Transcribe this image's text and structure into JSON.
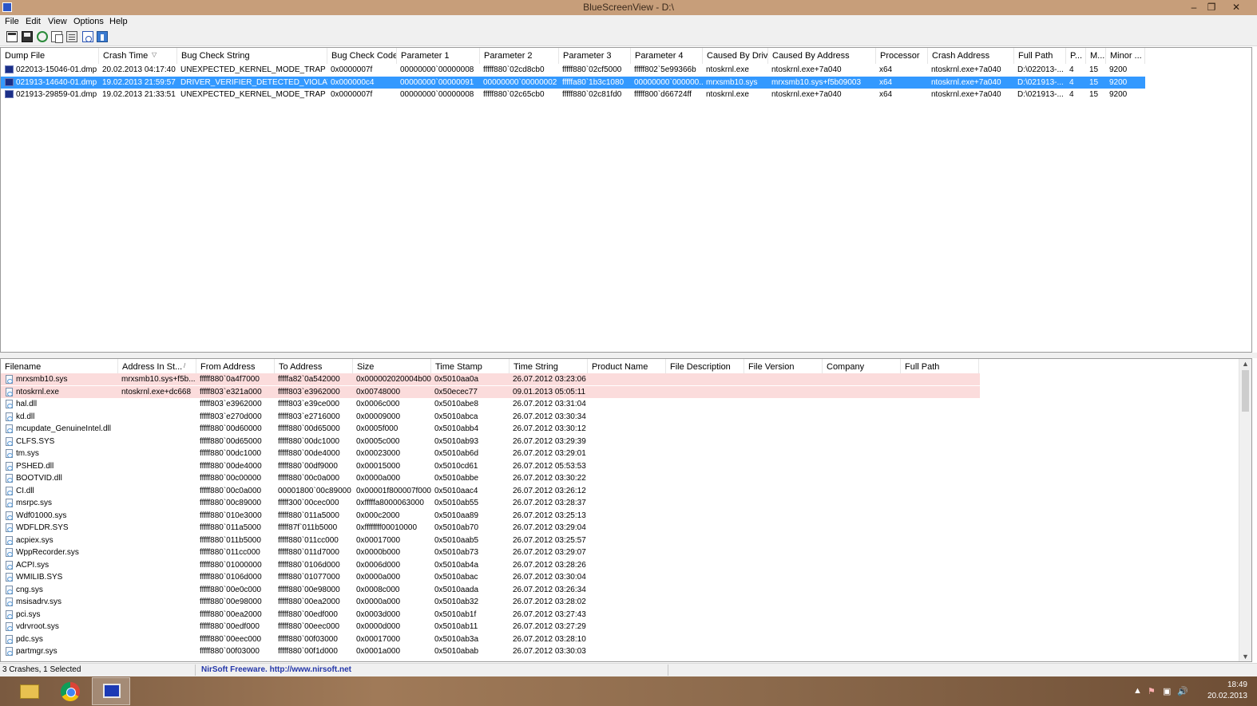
{
  "window": {
    "title": "BlueScreenView  -  D:\\",
    "minimize": "–",
    "restore": "❐",
    "close": "✕"
  },
  "menu": [
    "File",
    "Edit",
    "View",
    "Options",
    "Help"
  ],
  "toolbar": [
    "open-icon",
    "save-icon",
    "refresh-icon",
    "copy-icon",
    "properties-icon",
    "html-report-icon",
    "exit-icon"
  ],
  "upper": {
    "columns": [
      "Dump File",
      "Crash Time",
      "Bug Check String",
      "Bug Check Code",
      "Parameter 1",
      "Parameter 2",
      "Parameter 3",
      "Parameter 4",
      "Caused By Driver",
      "Caused By Address",
      "Processor",
      "Crash Address",
      "Full Path",
      "P...",
      "M...",
      "Minor ..."
    ],
    "sort_indicator": "▽",
    "rows": [
      [
        "022013-15046-01.dmp",
        "20.02.2013 04:17:40",
        "UNEXPECTED_KERNEL_MODE_TRAP",
        "0x0000007f",
        "00000000`00000008",
        "fffff880`02cd8cb0",
        "fffff880`02cf5000",
        "fffff802`5e99366b",
        "ntoskrnl.exe",
        "ntoskrnl.exe+7a040",
        "x64",
        "ntoskrnl.exe+7a040",
        "D:\\022013-...",
        "4",
        "15",
        "9200"
      ],
      [
        "021913-14640-01.dmp",
        "19.02.2013 21:59:57",
        "DRIVER_VERIFIER_DETECTED_VIOLATION",
        "0x000000c4",
        "00000000`00000091",
        "00000000`00000002",
        "fffffa80`1b3c1080",
        "00000000`000000...",
        "mrxsmb10.sys",
        "mrxsmb10.sys+f5b09003",
        "x64",
        "ntoskrnl.exe+7a040",
        "D:\\021913-...",
        "4",
        "15",
        "9200"
      ],
      [
        "021913-29859-01.dmp",
        "19.02.2013 21:33:51",
        "UNEXPECTED_KERNEL_MODE_TRAP",
        "0x0000007f",
        "00000000`00000008",
        "fffff880`02c65cb0",
        "fffff880`02c81fd0",
        "fffff800`d66724ff",
        "ntoskrnl.exe",
        "ntoskrnl.exe+7a040",
        "x64",
        "ntoskrnl.exe+7a040",
        "D:\\021913-...",
        "4",
        "15",
        "9200"
      ]
    ],
    "selected_row": 1
  },
  "lower": {
    "columns": [
      "Filename",
      "Address In St...",
      "From Address",
      "To Address",
      "Size",
      "Time Stamp",
      "Time String",
      "Product Name",
      "File Description",
      "File Version",
      "Company",
      "Full Path"
    ],
    "sort_indicator": "/",
    "rows": [
      [
        "mrxsmb10.sys",
        "mrxsmb10.sys+f5b...",
        "fffff880`0a4f7000",
        "fffffa82`0a542000",
        "0x000002020004b000",
        "0x5010aa0a",
        "26.07.2012 03:23:06"
      ],
      [
        "ntoskrnl.exe",
        "ntoskrnl.exe+dc668",
        "fffff803`e321a000",
        "fffff803`e3962000",
        "0x00748000",
        "0x50ecec77",
        "09.01.2013 05:05:11"
      ],
      [
        "hal.dll",
        "",
        "fffff803`e3962000",
        "fffff803`e39ce000",
        "0x0006c000",
        "0x5010abe8",
        "26.07.2012 03:31:04"
      ],
      [
        "kd.dll",
        "",
        "fffff803`e270d000",
        "fffff803`e2716000",
        "0x00009000",
        "0x5010abca",
        "26.07.2012 03:30:34"
      ],
      [
        "mcupdate_GenuineIntel.dll",
        "",
        "fffff880`00d60000",
        "fffff880`00d65000",
        "0x0005f000",
        "0x5010abb4",
        "26.07.2012 03:30:12"
      ],
      [
        "CLFS.SYS",
        "",
        "fffff880`00d65000",
        "fffff880`00dc1000",
        "0x0005c000",
        "0x5010ab93",
        "26.07.2012 03:29:39"
      ],
      [
        "tm.sys",
        "",
        "fffff880`00dc1000",
        "fffff880`00de4000",
        "0x00023000",
        "0x5010ab6d",
        "26.07.2012 03:29:01"
      ],
      [
        "PSHED.dll",
        "",
        "fffff880`00de4000",
        "fffff880`00df9000",
        "0x00015000",
        "0x5010cd61",
        "26.07.2012 05:53:53"
      ],
      [
        "BOOTVID.dll",
        "",
        "fffff880`00c00000",
        "fffff880`00c0a000",
        "0x0000a000",
        "0x5010abbe",
        "26.07.2012 03:30:22"
      ],
      [
        "CI.dll",
        "",
        "fffff880`00c0a000",
        "00001800`00c89000",
        "0x00001f800007f000",
        "0x5010aac4",
        "26.07.2012 03:26:12"
      ],
      [
        "msrpc.sys",
        "",
        "fffff880`00c89000",
        "fffff300`00cec000",
        "0xfffffa8000063000",
        "0x5010ab55",
        "26.07.2012 03:28:37"
      ],
      [
        "Wdf01000.sys",
        "",
        "fffff880`010e3000",
        "fffff880`011a5000",
        "0x000c2000",
        "0x5010aa89",
        "26.07.2012 03:25:13"
      ],
      [
        "WDFLDR.SYS",
        "",
        "fffff880`011a5000",
        "fffff87f`011b5000",
        "0xffffffff00010000",
        "0x5010ab70",
        "26.07.2012 03:29:04"
      ],
      [
        "acpiex.sys",
        "",
        "fffff880`011b5000",
        "fffff880`011cc000",
        "0x00017000",
        "0x5010aab5",
        "26.07.2012 03:25:57"
      ],
      [
        "WppRecorder.sys",
        "",
        "fffff880`011cc000",
        "fffff880`011d7000",
        "0x0000b000",
        "0x5010ab73",
        "26.07.2012 03:29:07"
      ],
      [
        "ACPI.sys",
        "",
        "fffff880`01000000",
        "fffff880`0106d000",
        "0x0006d000",
        "0x5010ab4a",
        "26.07.2012 03:28:26"
      ],
      [
        "WMILIB.SYS",
        "",
        "fffff880`0106d000",
        "fffff880`01077000",
        "0x0000a000",
        "0x5010abac",
        "26.07.2012 03:30:04"
      ],
      [
        "cng.sys",
        "",
        "fffff880`00e0c000",
        "fffff880`00e98000",
        "0x0008c000",
        "0x5010aada",
        "26.07.2012 03:26:34"
      ],
      [
        "msisadrv.sys",
        "",
        "fffff880`00e98000",
        "fffff880`00ea2000",
        "0x0000a000",
        "0x5010ab32",
        "26.07.2012 03:28:02"
      ],
      [
        "pci.sys",
        "",
        "fffff880`00ea2000",
        "fffff880`00edf000",
        "0x0003d000",
        "0x5010ab1f",
        "26.07.2012 03:27:43"
      ],
      [
        "vdrvroot.sys",
        "",
        "fffff880`00edf000",
        "fffff880`00eec000",
        "0x0000d000",
        "0x5010ab11",
        "26.07.2012 03:27:29"
      ],
      [
        "pdc.sys",
        "",
        "fffff880`00eec000",
        "fffff880`00f03000",
        "0x00017000",
        "0x5010ab3a",
        "26.07.2012 03:28:10"
      ],
      [
        "partmgr.sys",
        "",
        "fffff880`00f03000",
        "fffff880`00f1d000",
        "0x0001a000",
        "0x5010abab",
        "26.07.2012 03:30:03"
      ]
    ],
    "highlighted_rows": [
      0,
      1
    ]
  },
  "status": {
    "crashes": "3 Crashes, 1 Selected",
    "freeware": "NirSoft Freeware.  http://www.nirsoft.net"
  },
  "taskbar": {
    "apps": [
      "file-explorer-icon",
      "chrome-icon",
      "bluescreenview-icon"
    ],
    "tray": [
      "▲",
      "⚑",
      "▣",
      "🔊"
    ],
    "time": "18:49",
    "date": "20.02.2013"
  },
  "colors": {
    "selection": "#3399ff",
    "highlight": "#fbdcdc",
    "titlebar": "#c79e7a",
    "link": "#2336a8"
  }
}
